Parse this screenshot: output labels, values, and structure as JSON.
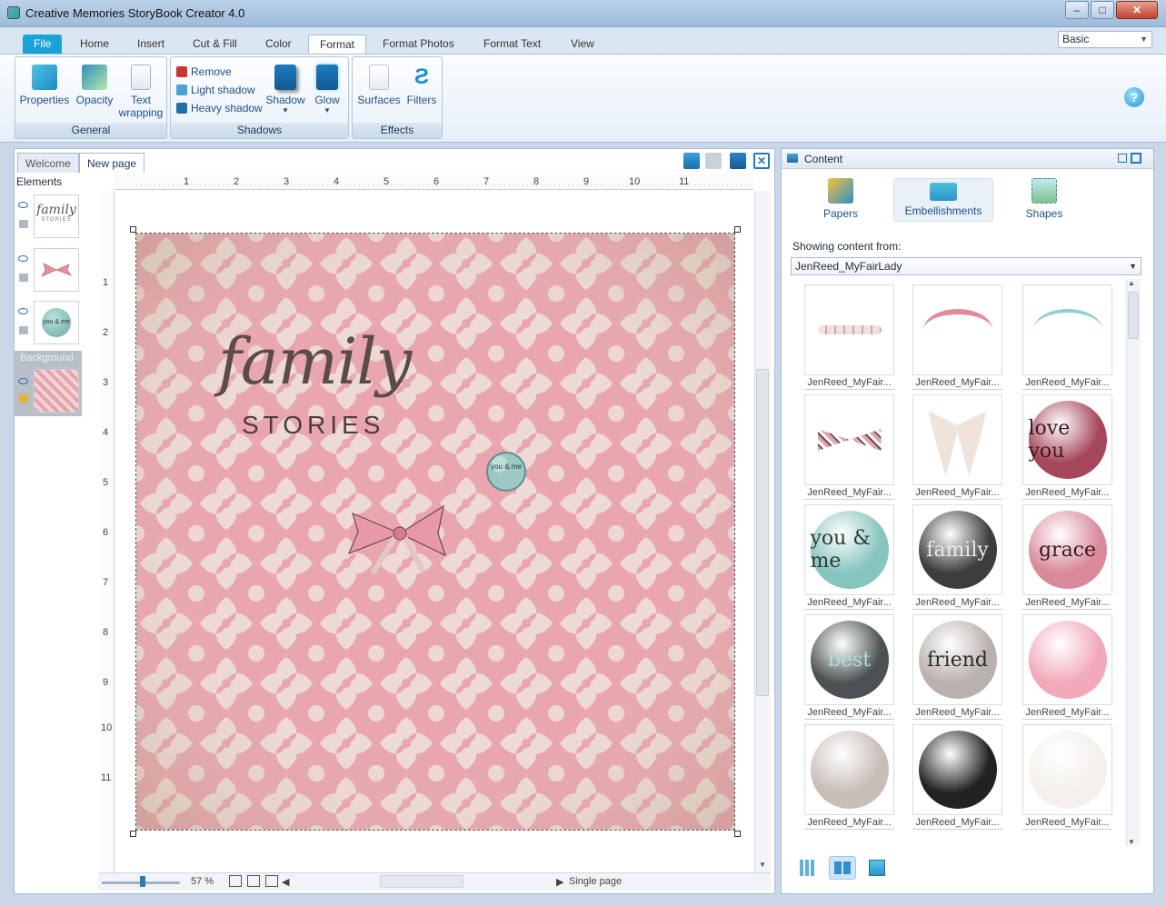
{
  "window": {
    "title": "Creative Memories StoryBook Creator 4.0",
    "minimize": "–",
    "maximize": "□",
    "close": "✕"
  },
  "ribbon_tabs": [
    "File",
    "Home",
    "Insert",
    "Cut & Fill",
    "Color",
    "Format",
    "Format Photos",
    "Format Text",
    "View"
  ],
  "mode_select": "Basic",
  "ribbon": {
    "general": {
      "caption": "General",
      "properties": "Properties",
      "opacity": "Opacity",
      "text_wrapping_1": "Text",
      "text_wrapping_2": "wrapping"
    },
    "shadows": {
      "caption": "Shadows",
      "remove": "Remove",
      "light": "Light shadow",
      "heavy": "Heavy shadow",
      "shadow": "Shadow",
      "glow": "Glow",
      "arrow": "▼"
    },
    "effects": {
      "caption": "Effects",
      "surfaces": "Surfaces",
      "filters": "Filters"
    }
  },
  "help": "?",
  "doc_tabs": [
    "Welcome",
    "New page"
  ],
  "elements": {
    "label": "Elements",
    "background": "Background",
    "thumb_family": "family",
    "thumb_stories": "STORIES",
    "thumb_youme": "you & me"
  },
  "ruler_h": [
    "1",
    "2",
    "3",
    "4",
    "5",
    "6",
    "7",
    "8",
    "9",
    "10",
    "11"
  ],
  "ruler_v": [
    "1",
    "2",
    "3",
    "4",
    "5",
    "6",
    "7",
    "8",
    "9",
    "10",
    "11"
  ],
  "canvas": {
    "title_word": "family",
    "subtitle": "STORIES",
    "button_text": "you & me"
  },
  "status": {
    "zoom": "57 %",
    "view_mode": "Single page",
    "left_arrow": "◀",
    "right_arrow": "▶"
  },
  "content": {
    "header": "Content",
    "tabs": {
      "papers": "Papers",
      "embellishments": "Embellishments",
      "shapes": "Shapes"
    },
    "showing_label": "Showing content from:",
    "source": "JenReed_MyFairLady",
    "items": [
      {
        "label": "JenReed_MyFair...",
        "kind": "pearls"
      },
      {
        "label": "JenReed_MyFair...",
        "kind": "ribbon-pink"
      },
      {
        "label": "JenReed_MyFair...",
        "kind": "ribbon-teal"
      },
      {
        "label": "JenReed_MyFair...",
        "kind": "bow-stripe"
      },
      {
        "label": "JenReed_MyFair...",
        "kind": "bow-cream"
      },
      {
        "label": "JenReed_MyFair...",
        "kind": "btn",
        "text": "love you",
        "bg": "#a5465a",
        "fg": "#3a1a22"
      },
      {
        "label": "JenReed_MyFair...",
        "kind": "btn",
        "text": "you & me",
        "bg": "#86c4be",
        "fg": "#2f3a3a"
      },
      {
        "label": "JenReed_MyFair...",
        "kind": "btn",
        "text": "family",
        "bg": "#3d3d3d",
        "fg": "#e8e8e8"
      },
      {
        "label": "JenReed_MyFair...",
        "kind": "btn",
        "text": "grace",
        "bg": "#d98a9a",
        "fg": "#3a1a22"
      },
      {
        "label": "JenReed_MyFair...",
        "kind": "btn",
        "text": "best",
        "bg": "#4c5253",
        "fg": "#a9e0dc"
      },
      {
        "label": "JenReed_MyFair...",
        "kind": "btn",
        "text": "friend",
        "bg": "#b9b1ad",
        "fg": "#2b2b2b"
      },
      {
        "label": "JenReed_MyFair...",
        "kind": "btn",
        "text": "",
        "bg": "#f2a9ba",
        "fg": "#fff"
      },
      {
        "label": "JenReed_MyFair...",
        "kind": "btn",
        "text": "",
        "bg": "#c9bdb8",
        "fg": "#fff"
      },
      {
        "label": "JenReed_MyFair...",
        "kind": "btn",
        "text": "",
        "bg": "#222",
        "fg": "#fff"
      },
      {
        "label": "JenReed_MyFair...",
        "kind": "btn",
        "text": "",
        "bg": "#f4f0ec",
        "fg": "#fff"
      }
    ]
  },
  "colors": {
    "accent": "#1aa3d9",
    "page_pink": "#e79aa6",
    "page_cream": "#ece4d9"
  }
}
